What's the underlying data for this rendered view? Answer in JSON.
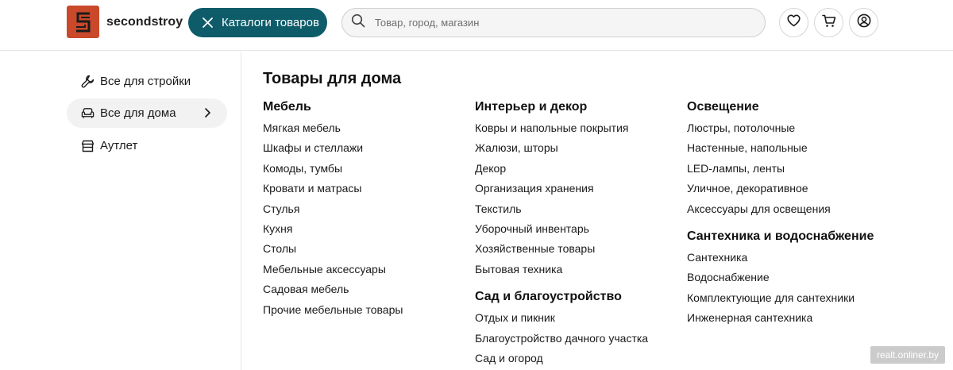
{
  "header": {
    "brand": "secondstroy",
    "catalog_label": "Каталоги товаров",
    "search_placeholder": "Товар, город, магазин"
  },
  "sidebar": {
    "items": [
      {
        "label": "Все для стройки",
        "icon": "wrench-icon"
      },
      {
        "label": "Все для дома",
        "icon": "sofa-icon",
        "active": true
      },
      {
        "label": "Аутлет",
        "icon": "store-icon"
      }
    ]
  },
  "main": {
    "title": "Товары для дома",
    "columns": [
      {
        "groups": [
          {
            "heading": "Мебель",
            "links": [
              "Мягкая мебель",
              "Шкафы и стеллажи",
              "Комоды, тумбы",
              "Кровати и матрасы",
              "Стулья",
              "Кухня",
              "Столы",
              "Мебельные аксессуары",
              "Садовая мебель",
              "Прочие мебельные товары"
            ]
          }
        ]
      },
      {
        "groups": [
          {
            "heading": "Интерьер и декор",
            "links": [
              "Ковры и напольные покрытия",
              "Жалюзи, шторы",
              "Декор",
              "Организация хранения",
              "Текстиль",
              "Уборочный инвентарь",
              "Хозяйственные товары",
              "Бытовая техника"
            ]
          },
          {
            "heading": "Сад и благоустройство",
            "links": [
              "Отдых и пикник",
              "Благоустройство дачного участка",
              "Сад и огород"
            ]
          }
        ]
      },
      {
        "groups": [
          {
            "heading": "Освещение",
            "links": [
              "Люстры, потолочные",
              "Настенные, напольные",
              "LED-лампы, ленты",
              "Уличное, декоративное",
              "Аксессуары для освещения"
            ]
          },
          {
            "heading": "Сантехника и водоснабжение",
            "links": [
              "Сантехника",
              "Водоснабжение",
              "Комплектующие для сантехники",
              "Инженерная сантехника"
            ]
          }
        ]
      }
    ]
  },
  "watermark": "realt.onliner.by",
  "colors": {
    "brand": "#c9492a",
    "accent": "#0e5c6a"
  }
}
